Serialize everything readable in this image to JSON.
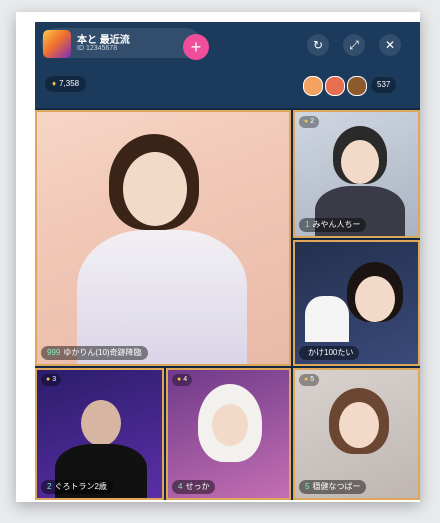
{
  "host": {
    "name": "本と 最近流",
    "subtitle": "ID 12345678",
    "follow_symbol": "+"
  },
  "top_icons": [
    {
      "name": "refresh-icon",
      "glyph": "↻"
    },
    {
      "name": "shrink-icon",
      "glyph": "⤢"
    },
    {
      "name": "close-icon",
      "glyph": "✕"
    }
  ],
  "coins": {
    "glyph": "♦",
    "value": "7,358"
  },
  "viewers": {
    "count": "537"
  },
  "tiles": [
    {
      "rank": "",
      "caption_num": "999",
      "caption": "ゆかりん(10)奇跡降臨"
    },
    {
      "rank": "2",
      "caption_num": "1",
      "caption": "みやん人ちー"
    },
    {
      "rank": "",
      "caption_num": "",
      "caption": "かけ100たい"
    },
    {
      "rank": "3",
      "caption_num": "2",
      "caption": "ぐろトラン2歳"
    },
    {
      "rank": "4",
      "caption_num": "4",
      "caption": "せっか"
    },
    {
      "rank": "5",
      "caption_num": "5",
      "caption": "穏健なつばー"
    }
  ],
  "colors": {
    "topbar": "#1b3a5c",
    "follow": "#f04d9a",
    "frame_border": "#e0a65a"
  }
}
